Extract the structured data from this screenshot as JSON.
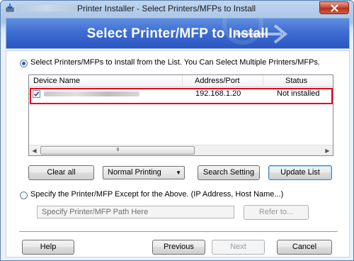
{
  "window": {
    "title": "Printer Installer - Select Printers/MFPs to Install"
  },
  "banner": {
    "title": "Select Printer/MFP to Install"
  },
  "option_list": {
    "label": "Select Printers/MFPs to Install from the List. You Can Select Multiple Printers/MFPs.",
    "selected": true
  },
  "device_list": {
    "columns": [
      "Device Name",
      "Address/Port",
      "Status"
    ],
    "rows": [
      {
        "checked": true,
        "name": "",
        "address": "192.168.1.20",
        "status": "Not installed"
      }
    ],
    "scroll_thumb": "III"
  },
  "list_buttons": {
    "clear_all": "Clear all",
    "printing_mode": "Normal Printing",
    "search_setting": "Search Setting",
    "update_list": "Update List"
  },
  "option_specify": {
    "label": "Specify the Printer/MFP Except for the Above. (IP Address, Host Name...)",
    "selected": false,
    "path_placeholder": "Specify Printer/MFP Path Here",
    "refer_button": "Refer to..."
  },
  "footer": {
    "help": "Help",
    "previous": "Previous",
    "next": "Next",
    "cancel": "Cancel"
  },
  "colors": {
    "banner": "#3f6ed3",
    "highlight": "#e2061a",
    "close": "#c7402a"
  }
}
